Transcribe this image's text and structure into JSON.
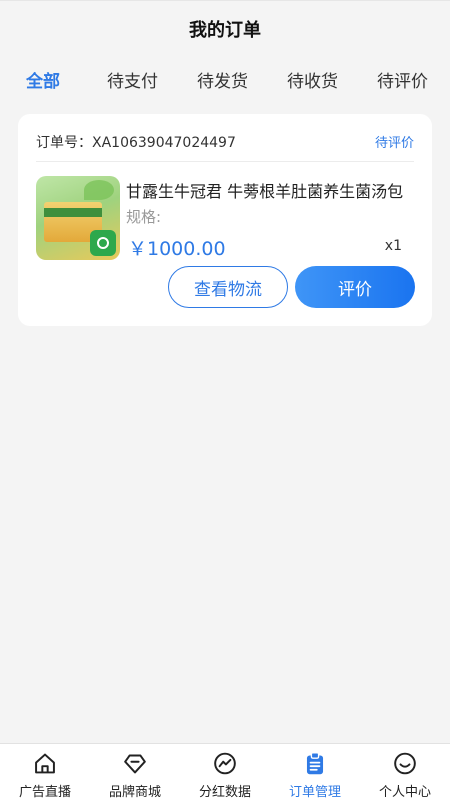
{
  "header": {
    "title": "我的订单"
  },
  "tabs": [
    {
      "label": "全部",
      "active": true
    },
    {
      "label": "待支付",
      "active": false
    },
    {
      "label": "待发货",
      "active": false
    },
    {
      "label": "待收货",
      "active": false
    },
    {
      "label": "待评价",
      "active": false
    }
  ],
  "order": {
    "number_label": "订单号：",
    "number_value": "XA10639047024497",
    "status": "待评价",
    "product": {
      "name": "甘露生牛冠君 牛蒡根羊肚菌养生菌汤包",
      "spec_label": "规格:",
      "price": "￥1000.00",
      "quantity": "x1",
      "thumbnail_icon": "product-thumbnail"
    },
    "actions": {
      "logistics_label": "查看物流",
      "review_label": "评价"
    }
  },
  "tabbar": [
    {
      "label": "广告直播",
      "icon": "home-icon",
      "active": false
    },
    {
      "label": "品牌商城",
      "icon": "diamond-icon",
      "active": false
    },
    {
      "label": "分红数据",
      "icon": "chart-icon",
      "active": false
    },
    {
      "label": "订单管理",
      "icon": "clipboard-icon",
      "active": true
    },
    {
      "label": "个人中心",
      "icon": "smile-icon",
      "active": false
    }
  ],
  "colors": {
    "accent": "#2f7ae5",
    "background": "#f4f4f4",
    "card": "#ffffff"
  }
}
